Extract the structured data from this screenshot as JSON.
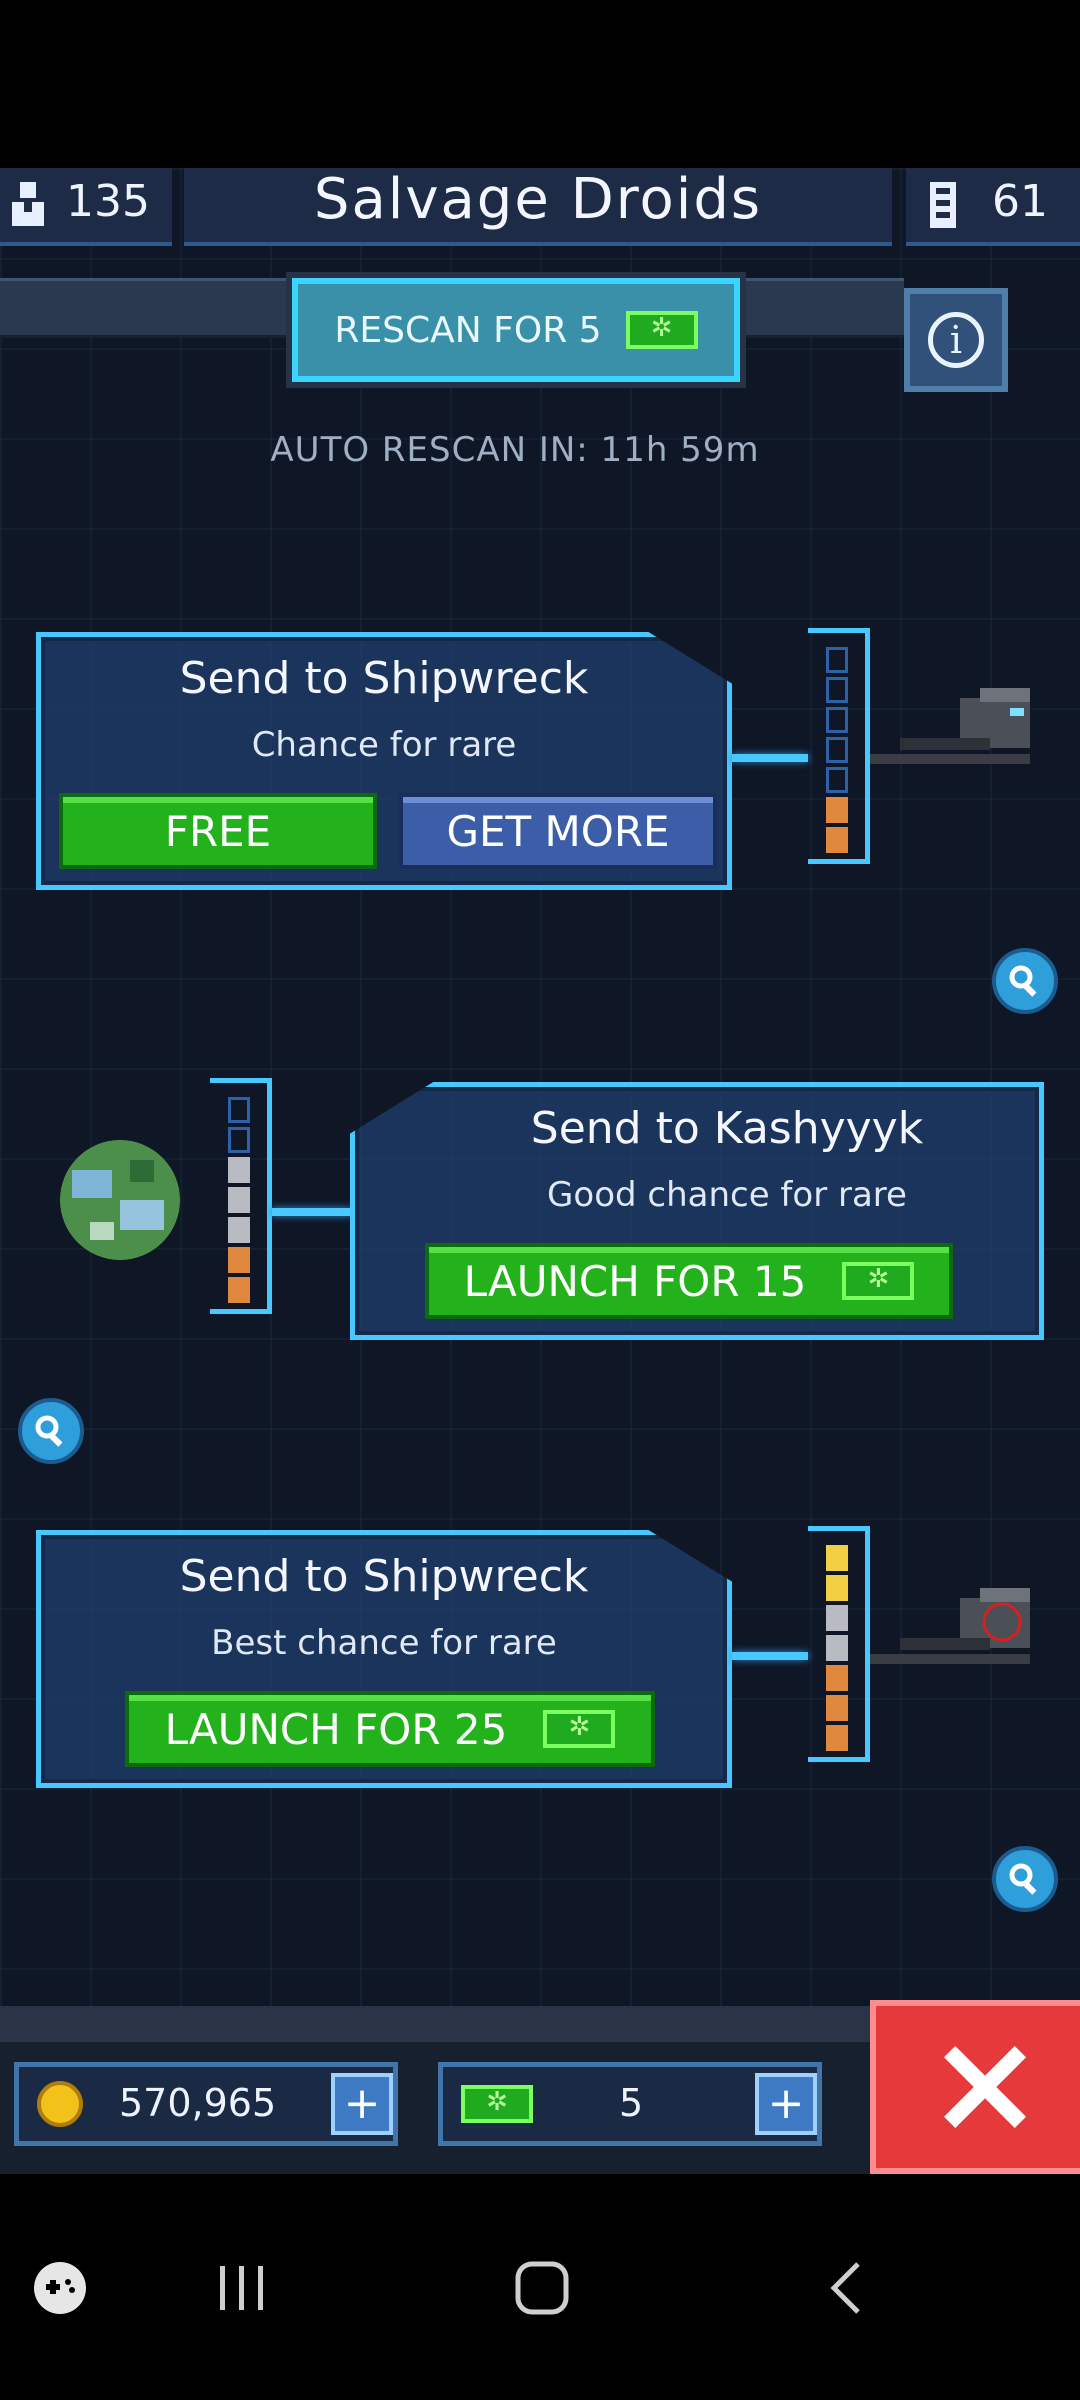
{
  "header": {
    "crew_count": "135",
    "title": "Salvage Droids",
    "parts_count": "61"
  },
  "rescan": {
    "label": "RESCAN FOR 5",
    "auto_label": "AUTO RESCAN IN: 11h 59m"
  },
  "missions": [
    {
      "title": "Send to Shipwreck",
      "subtitle": "Chance for rare",
      "free_label": "FREE",
      "more_label": "GET MORE",
      "gauge": [
        "empty",
        "empty",
        "empty",
        "empty",
        "empty",
        "orange",
        "orange"
      ]
    },
    {
      "title": "Send to Kashyyyk",
      "subtitle": "Good chance for rare",
      "launch_label": "LAUNCH FOR 15",
      "gauge": [
        "empty",
        "empty",
        "gray",
        "gray",
        "gray",
        "orange",
        "orange"
      ]
    },
    {
      "title": "Send to Shipwreck",
      "subtitle": "Best chance for rare",
      "launch_label": "LAUNCH FOR 25",
      "gauge": [
        "yellow",
        "yellow",
        "gray",
        "gray",
        "orange",
        "orange",
        "orange"
      ]
    }
  ],
  "resources": {
    "coins": "570,965",
    "gems": "5"
  },
  "colors": {
    "accent": "#49c7ff",
    "green": "#23b21c",
    "close": "#e5393c"
  },
  "icons": [
    "person-icon",
    "device-icon",
    "info-icon",
    "magnifier-icon",
    "coin-icon",
    "gem-icon",
    "plus-icon",
    "close-icon",
    "game-launcher-icon",
    "recents-icon",
    "home-icon",
    "back-icon"
  ]
}
